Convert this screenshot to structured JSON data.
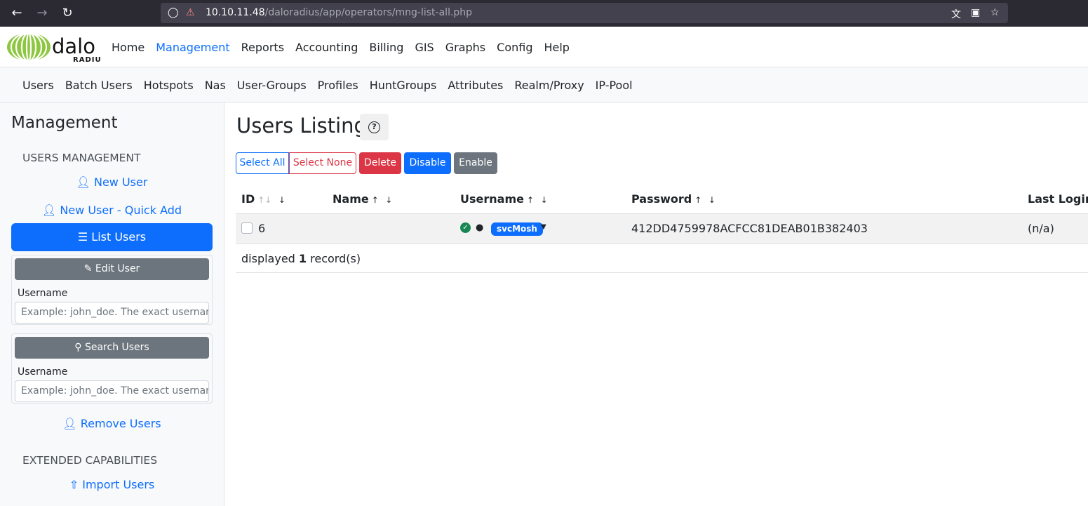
{
  "browser": {
    "url_host": "10.10.11.48",
    "url_path": "/daloradius/app/operators/mng-list-all.php"
  },
  "topnav": {
    "logo_text": "dalo",
    "logo_subtext": "RADIUS",
    "items": [
      "Home",
      "Management",
      "Reports",
      "Accounting",
      "Billing",
      "GIS",
      "Graphs",
      "Config",
      "Help"
    ],
    "active": "Management"
  },
  "subnav": {
    "items": [
      "Users",
      "Batch Users",
      "Hotspots",
      "Nas",
      "User-Groups",
      "Profiles",
      "HuntGroups",
      "Attributes",
      "Realm/Proxy",
      "IP-Pool"
    ]
  },
  "sidebar": {
    "title": "Management",
    "section_users": "USERS MANAGEMENT",
    "new_user": "New User",
    "new_user_quick": "New User - Quick Add",
    "list_users": "List Users",
    "edit_user": {
      "button": "Edit User",
      "label": "Username",
      "placeholder": "Example: john_doe. The exact username"
    },
    "search_users": {
      "button": "Search Users",
      "label": "Username",
      "placeholder": "Example: john_doe. The exact username"
    },
    "remove_users": "Remove Users",
    "section_extended": "EXTENDED CAPABILITIES",
    "import_users": "Import Users"
  },
  "main": {
    "title": "Users Listing",
    "help_label": "?",
    "buttons": {
      "select_all": "Select All",
      "select_none": "Select None",
      "delete": "Delete",
      "disable": "Disable",
      "enable": "Enable"
    },
    "table": {
      "headers": {
        "id": "ID",
        "name": "Name",
        "username": "Username",
        "password": "Password",
        "last_login": "Last Login"
      },
      "row": {
        "id": "6",
        "name": "",
        "username": "svcMosh",
        "password": "412DD4759978ACFCC81DEAB01B382403",
        "last_login": "(n/a)"
      },
      "footer_prefix": "displayed ",
      "footer_count": "1",
      "footer_suffix": " record(s)"
    }
  },
  "colors": {
    "primary": "#0d6efd",
    "danger": "#dc3545",
    "secondary": "#6c757d",
    "success": "#198754",
    "logo_green": "#8dc63f"
  }
}
